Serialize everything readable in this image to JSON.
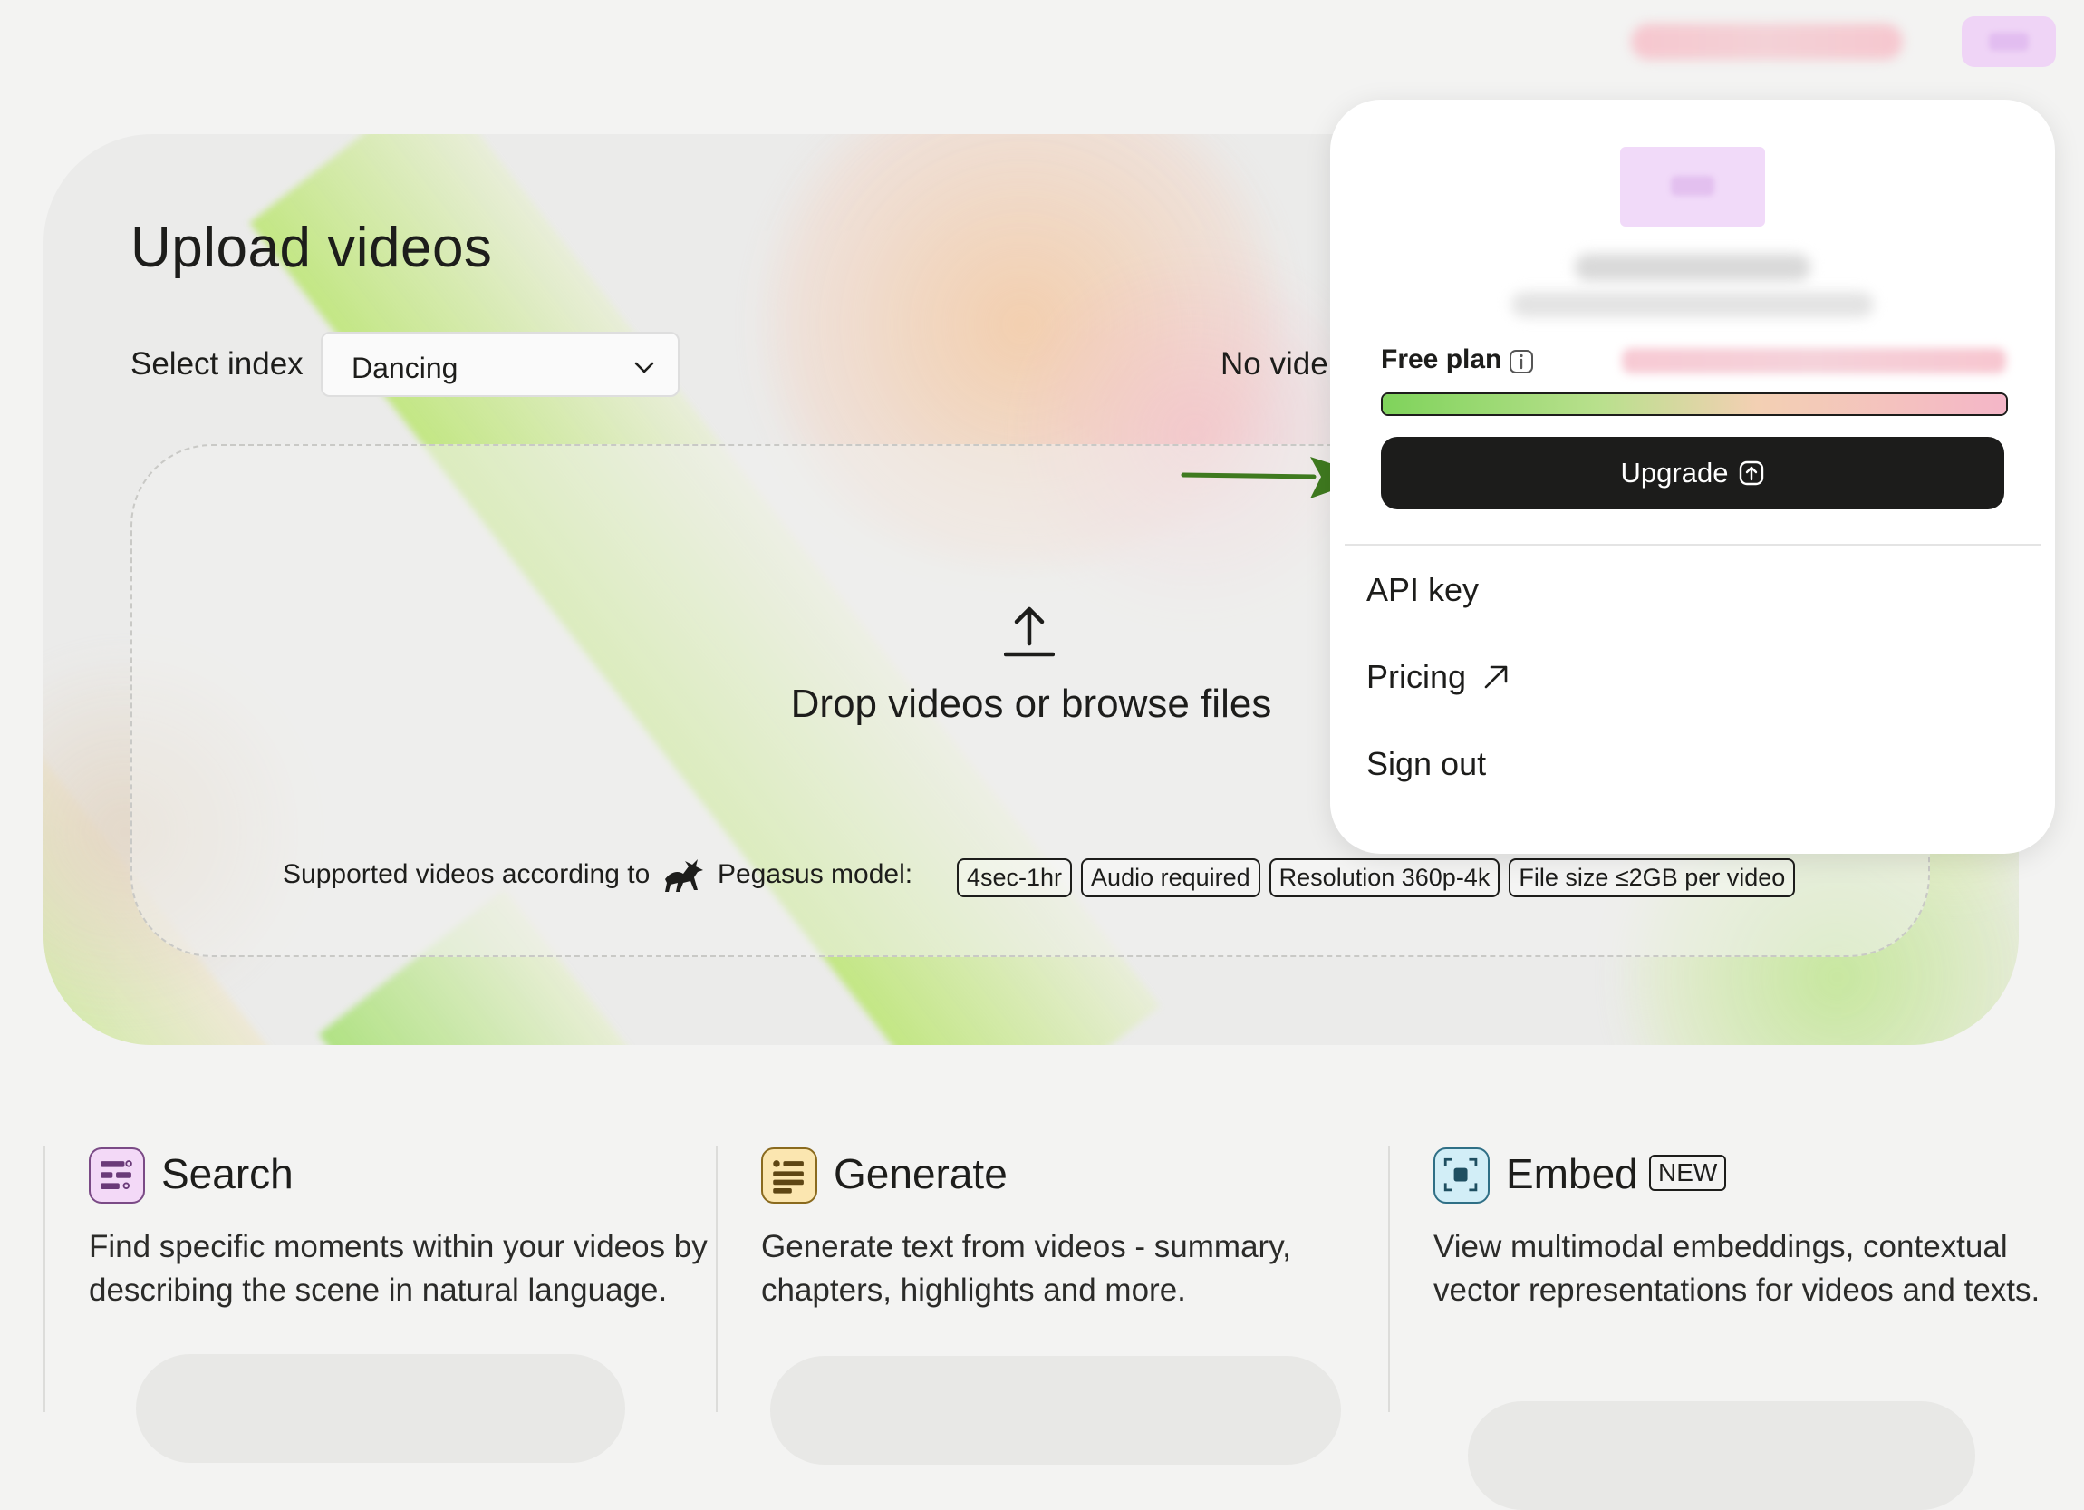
{
  "hero": {
    "title": "Upload videos",
    "select_label": "Select index",
    "selected_index": "Dancing",
    "no_video_text": "No vide",
    "drop_text": "Drop videos or browse files",
    "supported_prefix": "Supported videos according to",
    "supported_model": "Pegasus model:",
    "tags": [
      "4sec-1hr",
      "Audio required",
      "Resolution 360p-4k",
      "File size ≤2GB per video"
    ]
  },
  "menu": {
    "plan_label": "Free plan",
    "usage_fraction": 1.0,
    "upgrade_label": "Upgrade",
    "items": [
      "API key",
      "Pricing",
      "Sign out"
    ]
  },
  "features": [
    {
      "title": "Search",
      "desc": "Find specific moments within your videos by describing the scene in natural language.",
      "icon": "search-list-icon",
      "color": "#f3d9f7"
    },
    {
      "title": "Generate",
      "desc": "Generate text from videos - summary, chapters, highlights and more.",
      "icon": "text-lines-icon",
      "color": "#fbe6b0"
    },
    {
      "title": "Embed",
      "badge": "NEW",
      "desc": "View multimodal embeddings, contextual vector representations for videos and texts.",
      "icon": "embed-focus-icon",
      "color": "#d2eef7"
    }
  ],
  "colors": {
    "primary_button": "#1c1c1b",
    "annotation_arrow": "#3f7a1f",
    "accent_green": "#7fd35b",
    "accent_pink": "#f4b6c8"
  }
}
